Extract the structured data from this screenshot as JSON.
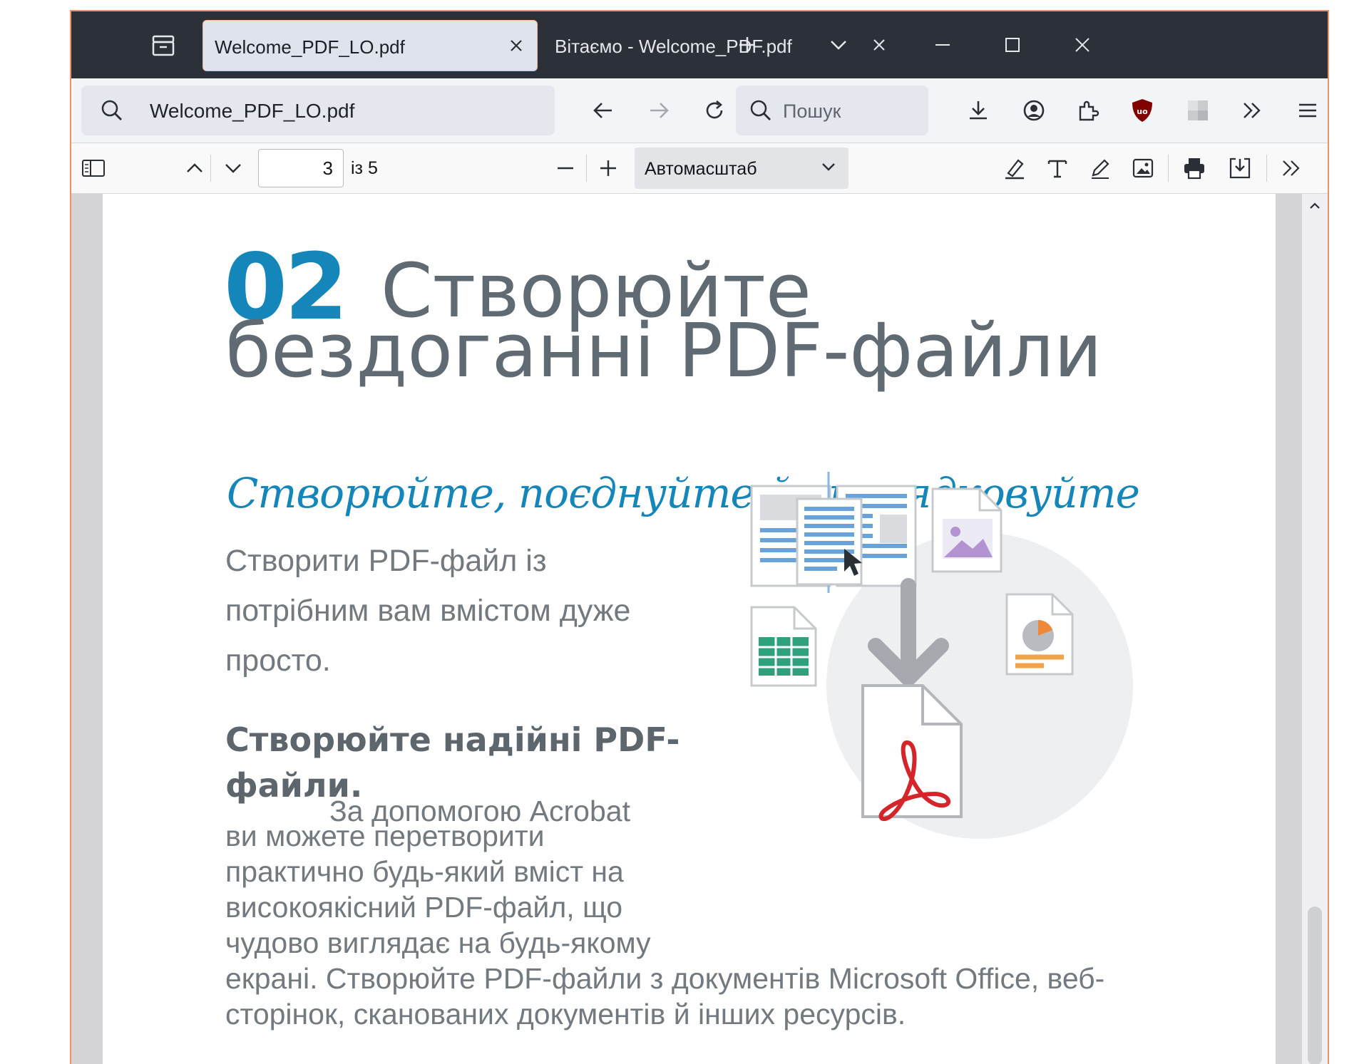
{
  "tabs": [
    {
      "title": "Welcome_PDF_LO.pdf",
      "active": true
    },
    {
      "title": "Вітаємо - Welcome_PDF.pdf",
      "active": false
    }
  ],
  "urlbar": {
    "value": "Welcome_PDF_LO.pdf"
  },
  "search": {
    "placeholder": "Пошук"
  },
  "pdf_toolbar": {
    "page_number": "3",
    "page_count": "із 5",
    "scale": "Автомасштаб"
  },
  "document": {
    "section_number": "02",
    "title_line1": "Створюйте",
    "title_line2": "бездоганні PDF-файли",
    "subheading": "Створюйте, поєднуйте й упорядковуйте",
    "intro_lines": [
      "Створити PDF-файл із",
      "потрібним вам вмістом дуже",
      "просто."
    ],
    "bold_heading": "Створюйте надійні PDF-файли.",
    "bold_continuation": "За допомогою Acrobat",
    "body_lines": [
      "ви можете перетворити",
      "практично будь-який вміст на",
      "високоякісний PDF-файл, що",
      "чудово виглядає на будь-якому",
      "екрані. Створюйте PDF-файли з документів Microsoft Office, веб-",
      "сторінок, сканованих документів й інших ресурсів."
    ]
  },
  "colors": {
    "accent_blue": "#1586b9",
    "heading_gray": "#606a72",
    "titlebar": "#2b3039",
    "acrobat_red": "#d4252b"
  }
}
